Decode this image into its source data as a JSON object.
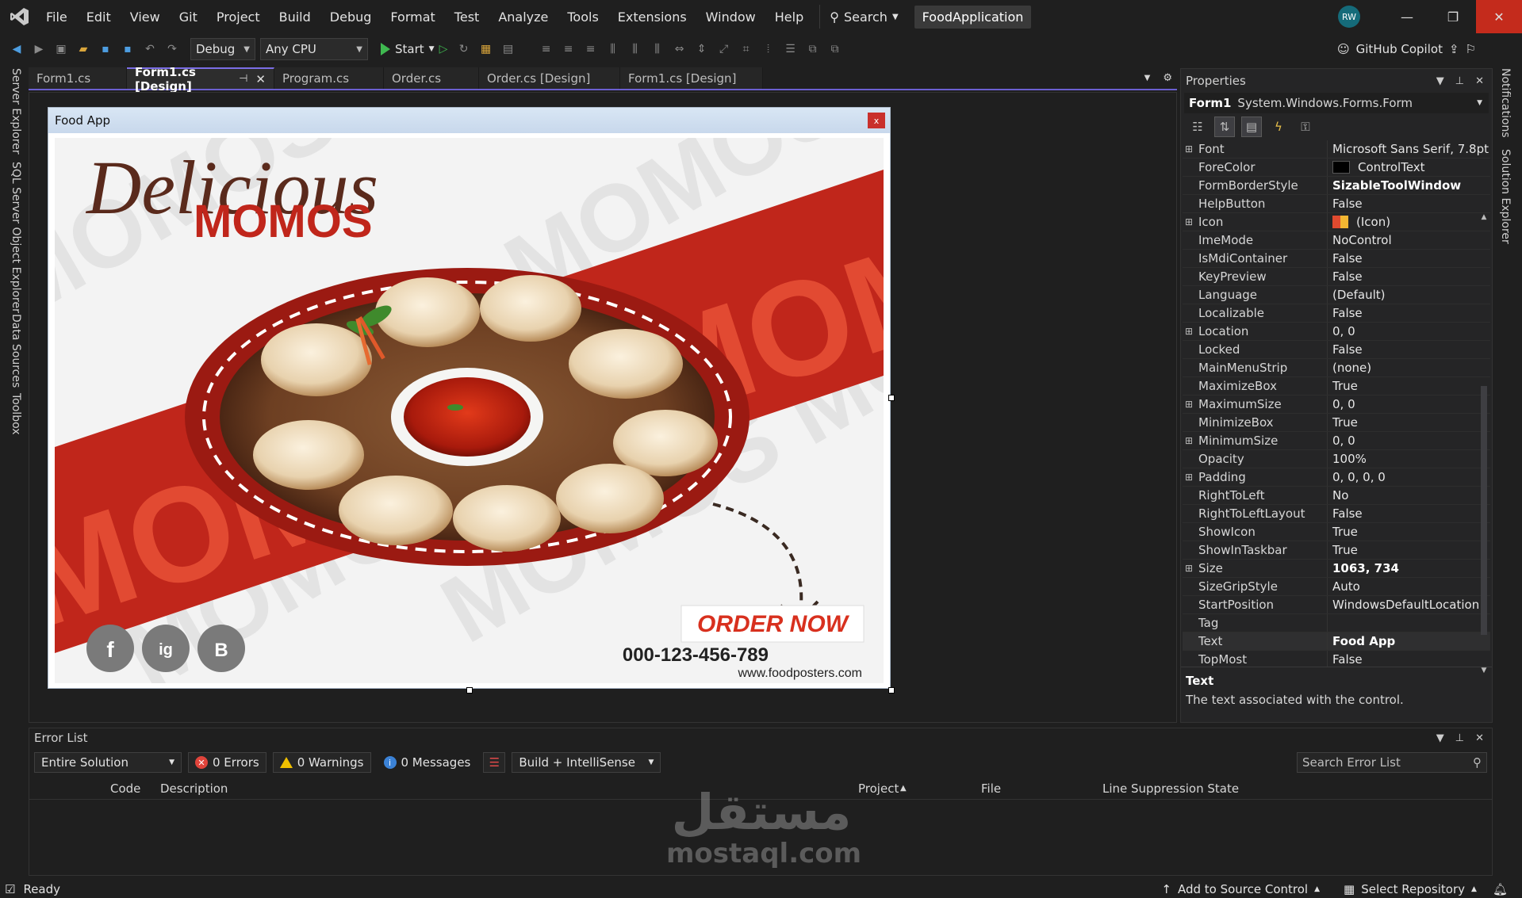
{
  "menu": [
    "File",
    "Edit",
    "View",
    "Git",
    "Project",
    "Build",
    "Debug",
    "Format",
    "Test",
    "Analyze",
    "Tools",
    "Extensions",
    "Window",
    "Help"
  ],
  "search_label": "Search",
  "app_name": "FoodApplication",
  "user_initials": "RW",
  "toolbar": {
    "config": "Debug",
    "platform": "Any CPU",
    "start_label": "Start",
    "copilot_label": "GitHub Copilot"
  },
  "left_strip": [
    "Server Explorer",
    "SQL Server Object Explorer",
    "Data Sources",
    "Toolbox"
  ],
  "right_strip": [
    "Notifications",
    "Solution Explorer"
  ],
  "tabs": [
    {
      "label": "Form1.cs"
    },
    {
      "label": "Form1.cs [Design]",
      "active": true
    },
    {
      "label": "Program.cs"
    },
    {
      "label": "Order.cs"
    },
    {
      "label": "Order.cs [Design]"
    },
    {
      "label": "Form1.cs [Design]"
    }
  ],
  "form": {
    "title": "Food App",
    "close": "x"
  },
  "poster": {
    "script_title": "Delicious",
    "title": "MOMOS",
    "cta": "ORDER NOW",
    "phone": "000-123-456-789",
    "website": "www.foodposters.com",
    "bg_word": "MOMOS",
    "band_word": "MOMO",
    "social": [
      "f",
      "ig",
      "B"
    ]
  },
  "properties": {
    "title": "Properties",
    "object_name": "Form1",
    "object_type": "System.Windows.Forms.Form",
    "rows": [
      {
        "name": "Font",
        "value": "Microsoft Sans Serif, 7.8pt",
        "expand": true
      },
      {
        "name": "ForeColor",
        "value": "ControlText",
        "swatch": "#000000"
      },
      {
        "name": "FormBorderStyle",
        "value": "SizableToolWindow",
        "bold": true
      },
      {
        "name": "HelpButton",
        "value": "False"
      },
      {
        "name": "Icon",
        "value": "(Icon)",
        "expand": true,
        "icon": true
      },
      {
        "name": "ImeMode",
        "value": "NoControl"
      },
      {
        "name": "IsMdiContainer",
        "value": "False"
      },
      {
        "name": "KeyPreview",
        "value": "False"
      },
      {
        "name": "Language",
        "value": "(Default)"
      },
      {
        "name": "Localizable",
        "value": "False"
      },
      {
        "name": "Location",
        "value": "0, 0",
        "expand": true
      },
      {
        "name": "Locked",
        "value": "False"
      },
      {
        "name": "MainMenuStrip",
        "value": "(none)"
      },
      {
        "name": "MaximizeBox",
        "value": "True"
      },
      {
        "name": "MaximumSize",
        "value": "0, 0",
        "expand": true
      },
      {
        "name": "MinimizeBox",
        "value": "True"
      },
      {
        "name": "MinimumSize",
        "value": "0, 0",
        "expand": true
      },
      {
        "name": "Opacity",
        "value": "100%"
      },
      {
        "name": "Padding",
        "value": "0, 0, 0, 0",
        "expand": true
      },
      {
        "name": "RightToLeft",
        "value": "No"
      },
      {
        "name": "RightToLeftLayout",
        "value": "False"
      },
      {
        "name": "ShowIcon",
        "value": "True"
      },
      {
        "name": "ShowInTaskbar",
        "value": "True"
      },
      {
        "name": "Size",
        "value": "1063, 734",
        "expand": true,
        "bold": true
      },
      {
        "name": "SizeGripStyle",
        "value": "Auto"
      },
      {
        "name": "StartPosition",
        "value": "WindowsDefaultLocation"
      },
      {
        "name": "Tag",
        "value": ""
      },
      {
        "name": "Text",
        "value": "Food App",
        "bold": true,
        "selected": true
      },
      {
        "name": "TopMost",
        "value": "False"
      }
    ],
    "desc_title": "Text",
    "desc_body": "The text associated with the control."
  },
  "error_list": {
    "title": "Error List",
    "scope": "Entire Solution",
    "errors": "0 Errors",
    "warnings": "0 Warnings",
    "messages": "0 Messages",
    "source": "Build + IntelliSense",
    "search_placeholder": "Search Error List",
    "columns": [
      "Code",
      "Description",
      "Project",
      "File",
      "Line",
      "Suppression State"
    ]
  },
  "status": {
    "ready": "Ready",
    "source_control": "Add to Source Control",
    "repository": "Select Repository"
  },
  "watermark": {
    "arabic": "مستقل",
    "latin": "mostaql.com"
  },
  "colors": {
    "accent": "#7b6ee6",
    "poster_red": "#c0261b",
    "cta_red": "#d8301e"
  }
}
